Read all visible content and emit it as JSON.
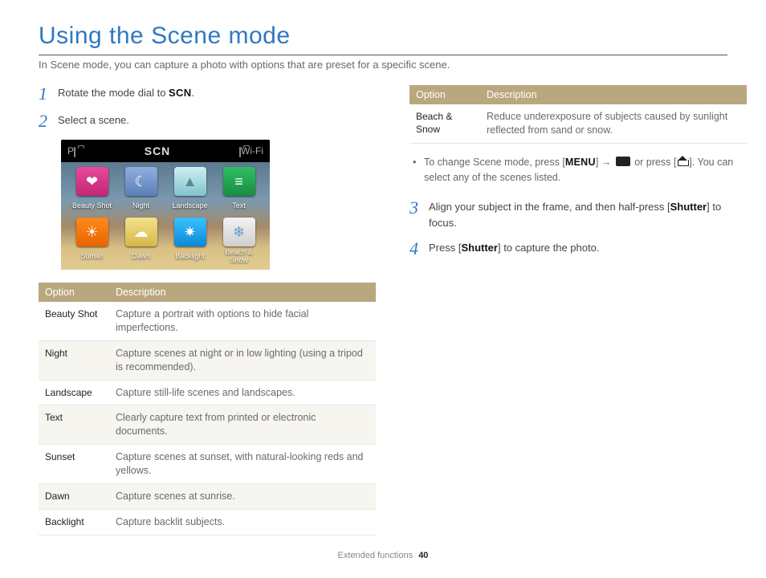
{
  "header": {
    "title": "Using the Scene mode",
    "intro": "In Scene mode, you can capture a photo with options that are preset for a specific scene."
  },
  "scn_label": "SCN",
  "shot": {
    "topbar_p": "P",
    "topbar_scn": "SCN",
    "topbar_wifi": "Wi-Fi"
  },
  "steps": {
    "s1": {
      "num": "1",
      "pre": "Rotate the mode dial to ",
      "post": "."
    },
    "s2": {
      "num": "2",
      "text": "Select a scene."
    },
    "s3": {
      "num": "3",
      "pre": "Align your subject in the frame, and then half-press [",
      "shutter": "Shutter",
      "post": "] to focus."
    },
    "s4": {
      "num": "4",
      "pre": "Press [",
      "shutter": "Shutter",
      "post": "] to capture the photo."
    }
  },
  "icons": [
    {
      "name": "Beauty Shot",
      "cls": "t-beauty",
      "glyph": "❤"
    },
    {
      "name": "Night",
      "cls": "t-night",
      "glyph": "☾"
    },
    {
      "name": "Landscape",
      "cls": "t-land",
      "glyph": "▲"
    },
    {
      "name": "Text",
      "cls": "t-text",
      "glyph": "≡"
    },
    {
      "name": "Sunset",
      "cls": "t-sunset",
      "glyph": "☀"
    },
    {
      "name": "Dawn",
      "cls": "t-dawn",
      "glyph": "☁"
    },
    {
      "name": "Backlight",
      "cls": "t-back",
      "glyph": "✷"
    },
    {
      "name": "Beach & Snow",
      "cls": "t-snow",
      "glyph": "❄"
    }
  ],
  "table": {
    "h1": "Option",
    "h2": "Description",
    "rows": [
      {
        "o": "Beauty Shot",
        "d": "Capture a portrait with options to hide facial imperfections."
      },
      {
        "o": "Night",
        "d": "Capture scenes at night or in low lighting (using a tripod is recommended)."
      },
      {
        "o": "Landscape",
        "d": "Capture still-life scenes and landscapes."
      },
      {
        "o": "Text",
        "d": "Clearly capture text from printed or electronic documents."
      },
      {
        "o": "Sunset",
        "d": "Capture scenes at sunset, with natural-looking reds and yellows."
      },
      {
        "o": "Dawn",
        "d": "Capture scenes at sunrise."
      },
      {
        "o": "Backlight",
        "d": "Capture backlit subjects."
      }
    ]
  },
  "table2": {
    "h1": "Option",
    "h2": "Description",
    "rows": [
      {
        "o": "Beach & Snow",
        "d": "Reduce underexposure of subjects caused by sunlight reflected from sand or snow."
      }
    ]
  },
  "note": {
    "bullet": "•",
    "a": "To change Scene mode, press [",
    "menu": "MENU",
    "b": "] → ",
    "c": " or press [",
    "d": "]. You can select any of the scenes listed."
  },
  "footer": {
    "section": "Extended functions",
    "page": "40"
  }
}
